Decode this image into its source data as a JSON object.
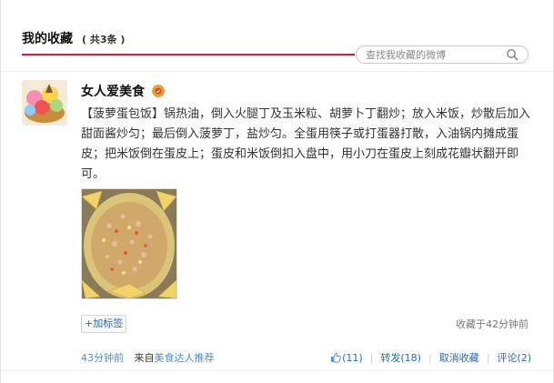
{
  "header": {
    "title": "我的收藏",
    "count": "( 共3条 )"
  },
  "search": {
    "placeholder": "查找我收藏的微博"
  },
  "post": {
    "author": "女人爱美食",
    "content": "【菠萝蛋包饭】锅热油，倒入火腿丁及玉米粒、胡萝卜丁翻炒；放入米饭，炒散后加入甜面酱炒匀；最后倒入菠萝丁，盐炒匀。全蛋用筷子或打蛋器打散，入油锅内摊成蛋皮；把米饭倒在蛋皮上；蛋皮和米饭倒扣入盘中，用小刀在蛋皮上刻成花瓣状翻开即可。",
    "add_tag": "+加标签",
    "collected": "收藏于42分钟前",
    "time": "43分钟前",
    "source_prefix": "来自",
    "source": "美食达人推荐",
    "like": "(11)",
    "forward": "转发(18)",
    "uncollect": "取消收藏",
    "comment": "评论(2)"
  },
  "colors": {
    "accent_red": "#d0202e",
    "link_blue": "#2a6bb5"
  }
}
